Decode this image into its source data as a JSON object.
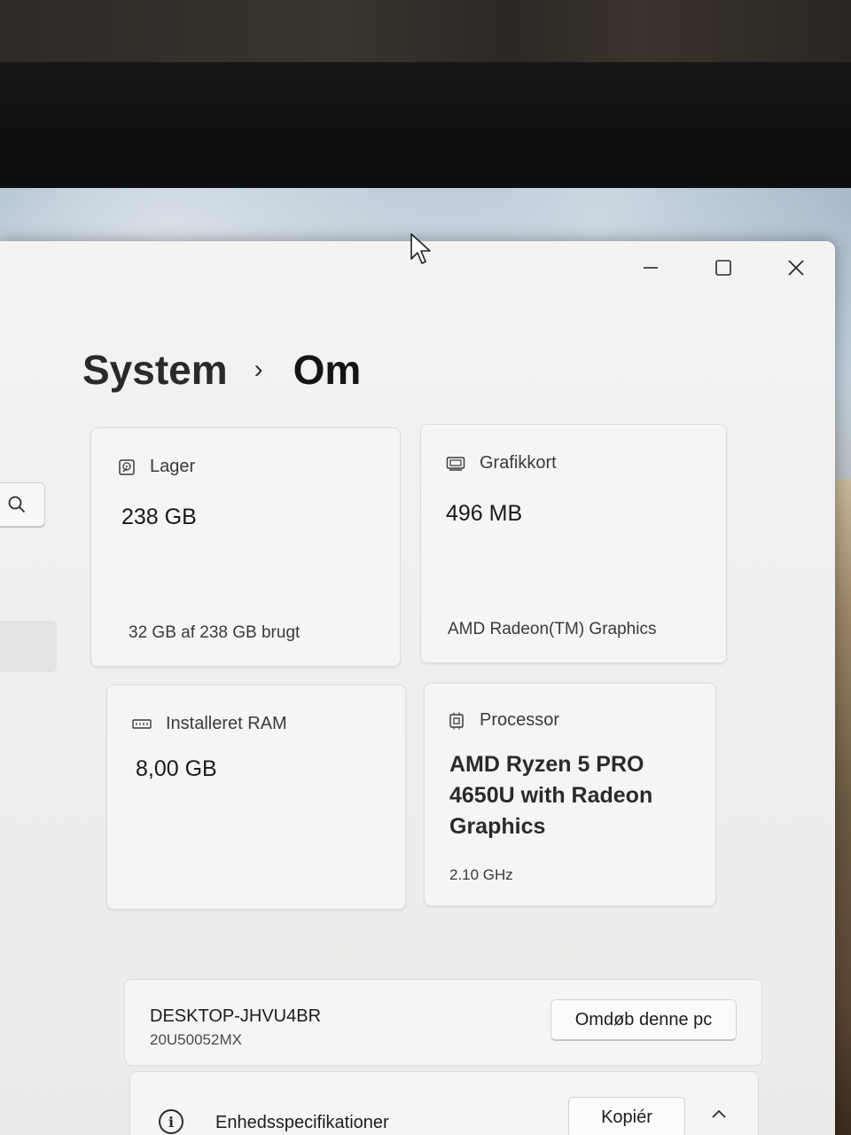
{
  "window": {
    "controls": {
      "minimize_icon": "minimize-icon",
      "maximize_icon": "maximize-icon",
      "close_icon": "close-icon"
    }
  },
  "sidebar": {
    "search_icon": "search-icon"
  },
  "breadcrumb": {
    "parent": "System",
    "separator": "›",
    "current": "Om"
  },
  "cards": {
    "storage": {
      "icon": "storage-icon",
      "label": "Lager",
      "value": "238 GB",
      "detail": "32 GB af 238 GB brugt"
    },
    "graphics": {
      "icon": "graphics-card-icon",
      "label": "Grafikkort",
      "value": "496 MB",
      "detail": "AMD Radeon(TM) Graphics"
    },
    "ram": {
      "icon": "memory-icon",
      "label": "Installeret RAM",
      "value": "8,00 GB"
    },
    "processor": {
      "icon": "processor-icon",
      "label": "Processor",
      "value_line1": "AMD Ryzen 5 PRO",
      "value_line2": "4650U with Radeon",
      "value_line3": "Graphics",
      "detail": "2.10 GHz"
    }
  },
  "device": {
    "name": "DESKTOP-JHVU4BR",
    "model": "20U50052MX",
    "rename_label": "Omdøb denne pc"
  },
  "specs": {
    "info_icon": "info-icon",
    "title": "Enhedsspecifikationer",
    "copy_label": "Kopiér",
    "collapse_icon": "chevron-up-icon"
  },
  "colors": {
    "window_bg": "#f0f1ef",
    "card_bg": "#f5f6f4",
    "text_primary": "#1c1c1c",
    "text_secondary": "#3a3a3a"
  }
}
